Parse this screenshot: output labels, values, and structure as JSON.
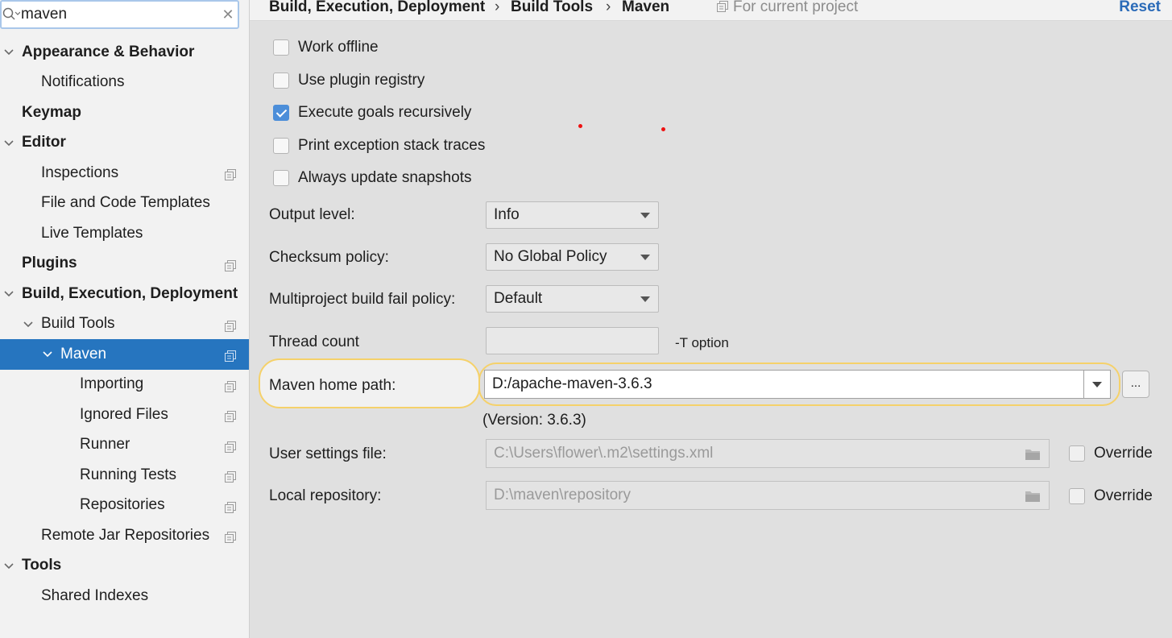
{
  "search": {
    "value": "maven",
    "icon": "search-icon",
    "clear_icon": "clear-icon"
  },
  "sidebar": {
    "items": [
      {
        "label": "Appearance & Behavior",
        "bold": true,
        "level": 0,
        "expanded": true
      },
      {
        "label": "Notifications",
        "bold": false,
        "level": 1
      },
      {
        "label": "Keymap",
        "bold": true,
        "level": 0
      },
      {
        "label": "Editor",
        "bold": true,
        "level": 0,
        "expanded": true
      },
      {
        "label": "Inspections",
        "bold": false,
        "level": 1,
        "project": true
      },
      {
        "label": "File and Code Templates",
        "bold": false,
        "level": 1
      },
      {
        "label": "Live Templates",
        "bold": false,
        "level": 1
      },
      {
        "label": "Plugins",
        "bold": true,
        "level": 0,
        "project": true
      },
      {
        "label": "Build, Execution, Deployment",
        "bold": true,
        "level": 0,
        "expanded": true
      },
      {
        "label": "Build Tools",
        "bold": false,
        "level": 1,
        "expanded": true,
        "project": true
      },
      {
        "label": "Maven",
        "bold": false,
        "level": 2,
        "expanded": true,
        "project": true,
        "selected": true
      },
      {
        "label": "Importing",
        "bold": false,
        "level": 3,
        "project": true
      },
      {
        "label": "Ignored Files",
        "bold": false,
        "level": 3,
        "project": true
      },
      {
        "label": "Runner",
        "bold": false,
        "level": 3,
        "project": true
      },
      {
        "label": "Running Tests",
        "bold": false,
        "level": 3,
        "project": true
      },
      {
        "label": "Repositories",
        "bold": false,
        "level": 3,
        "project": true
      },
      {
        "label": "Remote Jar Repositories",
        "bold": false,
        "level": 1,
        "project": true
      },
      {
        "label": "Tools",
        "bold": true,
        "level": 0,
        "expanded": true
      },
      {
        "label": "Shared Indexes",
        "bold": false,
        "level": 1
      }
    ]
  },
  "header": {
    "crumbs": [
      "Build, Execution, Deployment",
      "Build Tools",
      "Maven"
    ],
    "separator": "›",
    "scope": "For current project",
    "reset": "Reset"
  },
  "checkboxes": [
    {
      "label": "Work offline",
      "checked": false
    },
    {
      "label": "Use plugin registry",
      "checked": false
    },
    {
      "label": "Execute goals recursively",
      "checked": true
    },
    {
      "label": "Print exception stack traces",
      "checked": false
    },
    {
      "label": "Always update snapshots",
      "checked": false
    }
  ],
  "form": {
    "output_level": {
      "label": "Output level:",
      "value": "Info"
    },
    "checksum_policy": {
      "label": "Checksum policy:",
      "value": "No Global Policy"
    },
    "multiproject": {
      "label": "Multiproject build fail policy:",
      "value": "Default"
    },
    "thread_count": {
      "label": "Thread count",
      "value": "",
      "hint": "-T option"
    },
    "maven_home": {
      "label": "Maven home path:",
      "value": "D:/apache-maven-3.6.3",
      "browse": "...",
      "version": "(Version: 3.6.3)"
    },
    "user_settings": {
      "label": "User settings file:",
      "value": "C:\\Users\\flower\\.m2\\settings.xml",
      "override": "Override",
      "override_checked": false
    },
    "local_repo": {
      "label": "Local repository:",
      "value": "D:\\maven\\repository",
      "override": "Override",
      "override_checked": false
    }
  },
  "colors": {
    "selection": "#2675bf",
    "highlight": "#f5d16a",
    "link": "#2b6bb8",
    "checkbox_checked": "#4c8ed9"
  }
}
